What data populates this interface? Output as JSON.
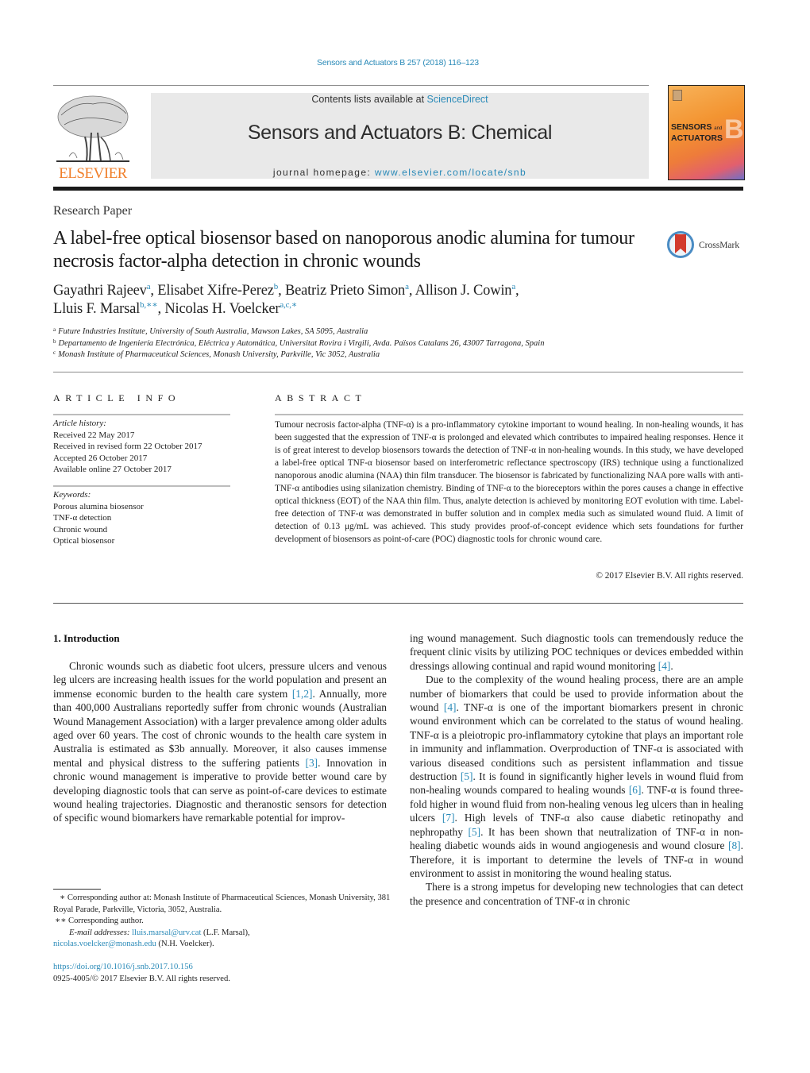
{
  "header": {
    "citation": "Sensors and Actuators B 257 (2018) 116–123",
    "contents_prefix": "Contents lists available at ",
    "contents_link": "ScienceDirect",
    "journal_title": "Sensors and Actuators B: Chemical",
    "homepage_prefix": "journal homepage: ",
    "homepage_link": "www.elsevier.com/locate/snb",
    "publisher_logo_text": "ELSEVIER",
    "cover_line1": "SENSORS",
    "cover_and": "and",
    "cover_line2": "ACTUATORS",
    "cover_letter": "B",
    "accent_color": "#2a8ab8",
    "publisher_color": "#f07f2a"
  },
  "article": {
    "type": "Research Paper",
    "title": "A label-free optical biosensor based on nanoporous anodic alumina for tumour necrosis factor-alpha detection in chronic wounds",
    "crossmark_label": "CrossMark",
    "authors": [
      {
        "name": "Gayathri Rajeev",
        "sup": "a",
        "sep": ", "
      },
      {
        "name": "Elisabet Xifre-Perez",
        "sup": "b",
        "sep": ", "
      },
      {
        "name": "Beatriz Prieto Simon",
        "sup": "a",
        "sep": ", "
      },
      {
        "name": "Allison J. Cowin",
        "sup": "a",
        "sep": ","
      },
      {
        "name": "Lluis F. Marsal",
        "sup": "b,∗∗",
        "sep": ", "
      },
      {
        "name": "Nicolas H. Voelcker",
        "sup": "a,c,∗",
        "sep": ""
      }
    ],
    "affiliations": [
      {
        "mark": "a",
        "text": "Future Industries Institute, University of South Australia, Mawson Lakes, SA 5095, Australia"
      },
      {
        "mark": "b",
        "text": "Departamento de Ingeniería Electrónica, Eléctrica y Automática, Universitat Rovira i Virgili, Avda. Països Catalans 26, 43007 Tarragona, Spain"
      },
      {
        "mark": "c",
        "text": "Monash Institute of Pharmaceutical Sciences, Monash University, Parkville, Vic 3052, Australia"
      }
    ]
  },
  "article_info": {
    "heading": "ARTICLE INFO",
    "history_label": "Article history:",
    "history": [
      "Received 22 May 2017",
      "Received in revised form 22 October 2017",
      "Accepted 26 October 2017",
      "Available online 27 October 2017"
    ],
    "keywords_label": "Keywords:",
    "keywords": [
      "Porous alumina biosensor",
      "TNF-α detection",
      "Chronic wound",
      "Optical biosensor"
    ]
  },
  "abstract": {
    "heading": "ABSTRACT",
    "text": "Tumour necrosis factor-alpha (TNF-α) is a pro-inflammatory cytokine important to wound healing. In non-healing wounds, it has been suggested that the expression of TNF-α is prolonged and elevated which contributes to impaired healing responses. Hence it is of great interest to develop biosensors towards the detection of TNF-α in non-healing wounds. In this study, we have developed a label-free optical TNF-α biosensor based on interferometric reflectance spectroscopy (IRS) technique using a functionalized nanoporous anodic alumina (NAA) thin film transducer. The biosensor is fabricated by functionalizing NAA pore walls with anti-TNF-α antibodies using silanization chemistry. Binding of TNF-α to the bioreceptors within the pores causes a change in effective optical thickness (EOT) of the NAA thin film. Thus, analyte detection is achieved by monitoring EOT evolution with time. Label-free detection of TNF-α was demonstrated in buffer solution and in complex media such as simulated wound fluid. A limit of detection of 0.13 μg/mL was achieved. This study provides proof-of-concept evidence which sets foundations for further development of biosensors as point-of-care (POC) diagnostic tools for chronic wound care.",
    "copyright": "© 2017 Elsevier B.V. All rights reserved."
  },
  "body": {
    "section_heading": "1.  Introduction",
    "left_column": [
      {
        "segments": [
          {
            "t": "Chronic wounds such as diabetic foot ulcers, pressure ulcers and venous leg ulcers are increasing health issues for the world population and present an immense economic burden to the health care system "
          },
          {
            "ref": "[1,2]"
          },
          {
            "t": ". Annually, more than 400,000 Australians reportedly suffer from chronic wounds (Australian Wound Management Association) with a larger prevalence among older adults aged over 60 years. The cost of chronic wounds to the health care system in Australia is estimated as $3b annually. Moreover, it also causes immense mental and physical distress to the suffering patients "
          },
          {
            "ref": "[3]"
          },
          {
            "t": ". Innovation in chronic wound management is imperative to provide better wound care by developing diagnostic tools that can serve as point-of-care devices to estimate wound healing trajectories. Diagnostic and theranostic sensors for detection of specific wound biomarkers have remarkable potential for improv-"
          }
        ]
      }
    ],
    "right_column": [
      {
        "indent": false,
        "segments": [
          {
            "t": "ing wound management. Such diagnostic tools can tremendously reduce the frequent clinic visits by utilizing POC techniques or devices embedded within dressings allowing continual and rapid wound monitoring "
          },
          {
            "ref": "[4]"
          },
          {
            "t": "."
          }
        ]
      },
      {
        "indent": true,
        "segments": [
          {
            "t": "Due to the complexity of the wound healing process, there are an ample number of biomarkers that could be used to provide information about the wound "
          },
          {
            "ref": "[4]"
          },
          {
            "t": ". TNF-α is one of the important biomarkers present in chronic wound environment which can be correlated to the status of wound healing. TNF-α is a pleiotropic pro-inflammatory cytokine that plays an important role in immunity and inflammation. Overproduction of TNF-α is associated with various diseased conditions such as persistent inflammation and tissue destruction "
          },
          {
            "ref": "[5]"
          },
          {
            "t": ". It is found in significantly higher levels in wound fluid from non-healing wounds compared to healing wounds "
          },
          {
            "ref": "[6]"
          },
          {
            "t": ". TNF-α is found three-fold higher in wound fluid from non-healing venous leg ulcers than in healing ulcers "
          },
          {
            "ref": "[7]"
          },
          {
            "t": ". High levels of TNF-α also cause diabetic retinopathy and nephropathy "
          },
          {
            "ref": "[5]"
          },
          {
            "t": ". It has been shown that neutralization of TNF-α in non-healing diabetic wounds aids in wound angiogenesis and wound closure "
          },
          {
            "ref": "[8]"
          },
          {
            "t": ". Therefore, it is important to determine the levels of TNF-α in wound environment to assist in monitoring the wound healing status."
          }
        ]
      },
      {
        "indent": true,
        "segments": [
          {
            "t": "There is a strong impetus for developing new technologies that can detect the presence and concentration of TNF-α in chronic"
          }
        ]
      }
    ]
  },
  "footnotes": {
    "note1": "∗  Corresponding author at: Monash Institute of Pharmaceutical Sciences, Monash University, 381 Royal Parade, Parkville, Victoria, 3052, Australia.",
    "note2": "∗∗  Corresponding author.",
    "email_label": "E-mail addresses:",
    "email1": "lluis.marsal@urv.cat",
    "email1_owner": " (L.F. Marsal),",
    "email2": "nicolas.voelcker@monash.edu",
    "email2_owner": " (N.H. Voelcker).",
    "doi": "https://doi.org/10.1016/j.snb.2017.10.156",
    "issn_copyright": "0925-4005/© 2017 Elsevier B.V. All rights reserved."
  }
}
